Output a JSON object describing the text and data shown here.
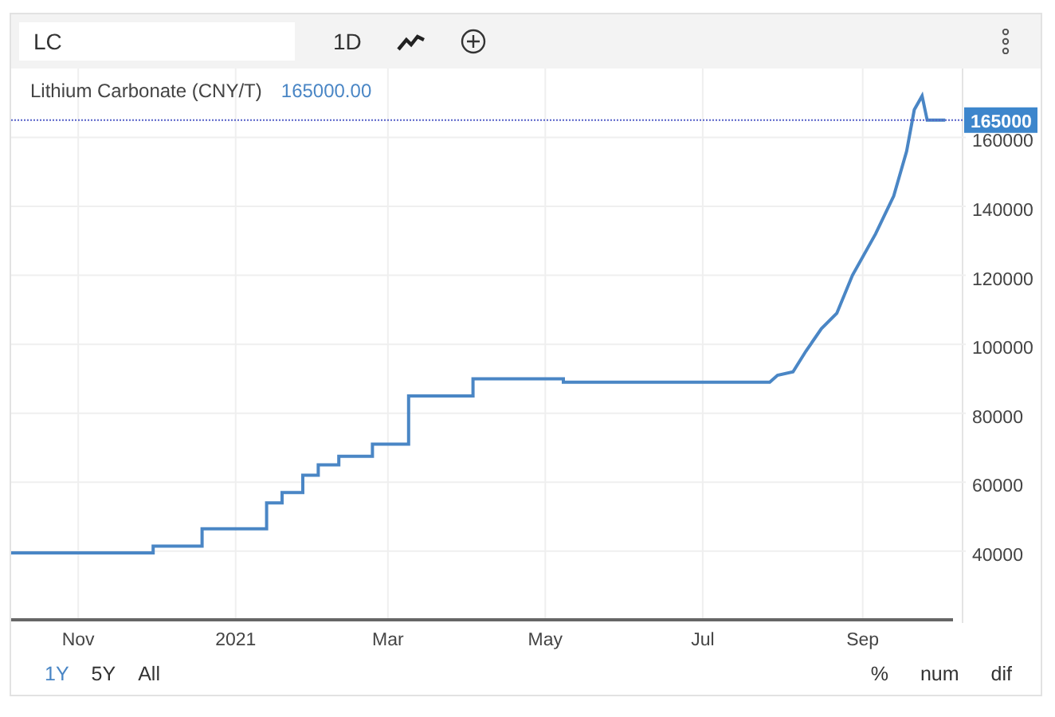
{
  "toolbar": {
    "symbol_field": {
      "value": "LC"
    },
    "interval": "1D"
  },
  "header": {
    "value": "165000.00"
  },
  "last_price_badge": "165000",
  "chart_data": {
    "type": "line",
    "x": [
      "2020-10-06",
      "2020-11-30",
      "2020-11-30",
      "2020-12-19",
      "2020-12-19",
      "2021-01-13",
      "2021-01-13",
      "2021-01-19",
      "2021-01-19",
      "2021-01-27",
      "2021-01-27",
      "2021-02-02",
      "2021-02-02",
      "2021-02-10",
      "2021-02-10",
      "2021-02-23",
      "2021-02-23",
      "2021-03-09",
      "2021-03-09",
      "2021-04-03",
      "2021-04-03",
      "2021-05-08",
      "2021-05-08",
      "2021-07-27",
      "2021-07-30",
      "2021-08-05",
      "2021-08-10",
      "2021-08-16",
      "2021-08-22",
      "2021-08-28",
      "2021-09-06",
      "2021-09-13",
      "2021-09-18",
      "2021-09-21",
      "2021-09-24",
      "2021-09-26",
      "2021-10-03"
    ],
    "series": [
      {
        "name": "Lithium Carbonate (CNY/T)",
        "color": "#4a86c5",
        "values": [
          39500,
          39500,
          41500,
          41500,
          46500,
          46500,
          54000,
          54000,
          57000,
          57000,
          62000,
          62000,
          65000,
          65000,
          67500,
          67500,
          71000,
          71000,
          85000,
          85000,
          90000,
          90000,
          89000,
          89000,
          91000,
          92000,
          98000,
          104500,
          109000,
          120000,
          132000,
          143000,
          156000,
          168000,
          172000,
          165000,
          165000
        ]
      }
    ],
    "grid": true,
    "ref_lines": [
      {
        "axis": "y",
        "value": 165000,
        "color": "#5560c8"
      }
    ],
    "xlim": [
      "2020-10-06",
      "2021-10-06"
    ],
    "ylim": [
      20100,
      179500
    ],
    "xticks": [
      {
        "value": "2020-11-01",
        "label": "Nov"
      },
      {
        "value": "2021-01-01",
        "label": "2021"
      },
      {
        "value": "2021-03-01",
        "label": "Mar"
      },
      {
        "value": "2021-05-01",
        "label": "May"
      },
      {
        "value": "2021-07-01",
        "label": "Jul"
      },
      {
        "value": "2021-09-01",
        "label": "Sep"
      }
    ],
    "yticks": [
      40000,
      60000,
      80000,
      100000,
      120000,
      140000,
      160000
    ]
  },
  "ranges": [
    {
      "label": "1Y",
      "selected": true
    },
    {
      "label": "5Y",
      "selected": false
    },
    {
      "label": "All",
      "selected": false
    }
  ],
  "modes": [
    "%",
    "num",
    "dif"
  ]
}
